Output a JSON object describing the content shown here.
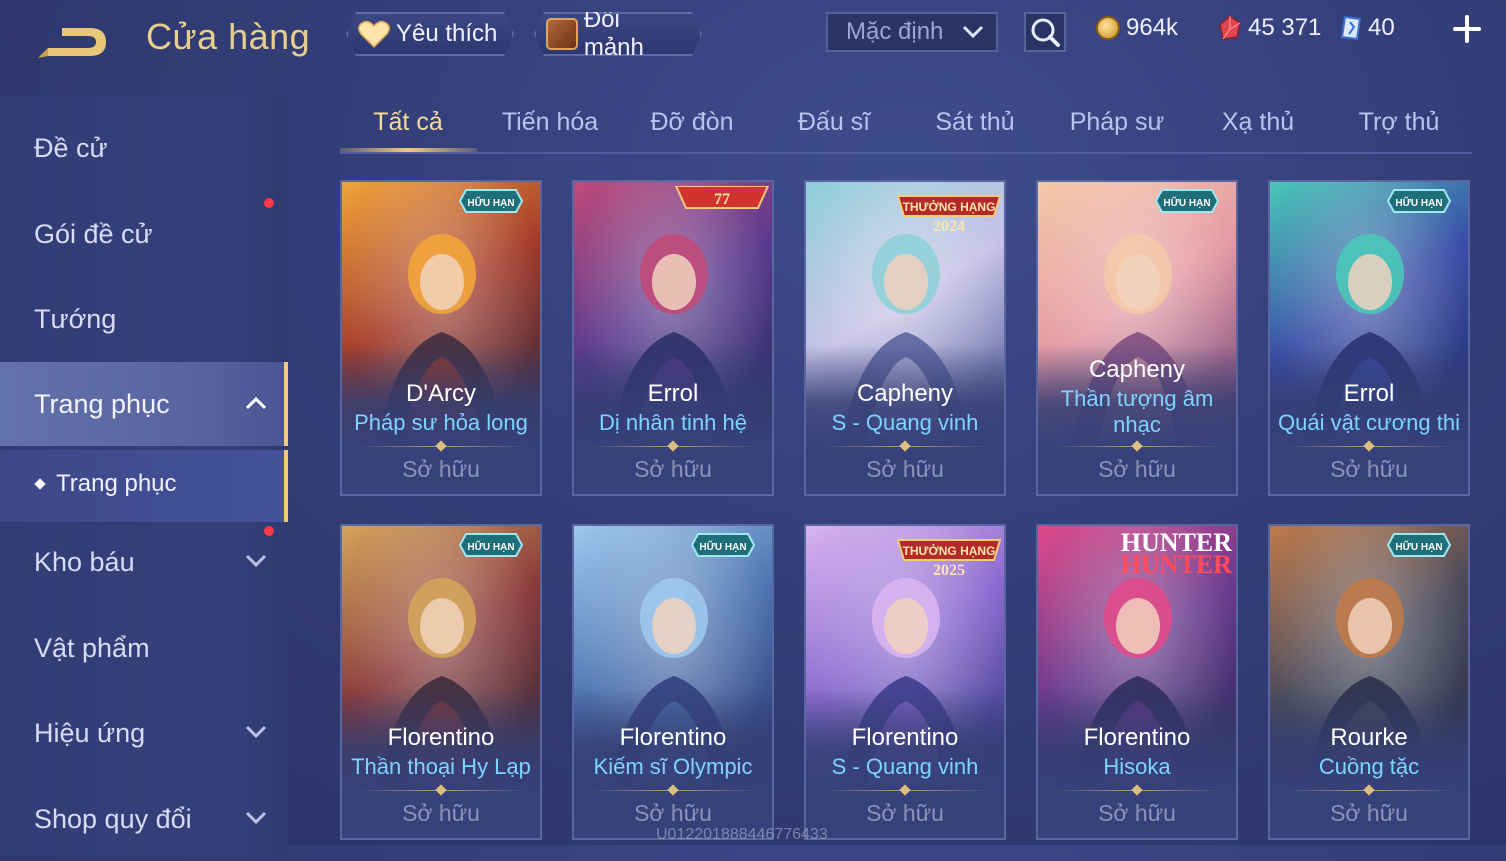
{
  "header": {
    "title": "Cửa hàng",
    "favorite_label": "Yêu thích",
    "fragment_label": "Đổi mảnh",
    "sort_value": "Mặc định",
    "gold": "964k",
    "ruby": "45 371",
    "voucher": "40"
  },
  "sidebar": {
    "items": [
      {
        "label": "Đề cử"
      },
      {
        "label": "Gói đề cử"
      },
      {
        "label": "Tướng"
      },
      {
        "label": "Trang phục"
      },
      {
        "label": "Kho báu"
      },
      {
        "label": "Vật phẩm"
      },
      {
        "label": "Hiệu ứng"
      },
      {
        "label": "Shop quy đổi"
      }
    ],
    "sub_item": "Trang phục"
  },
  "tabs": [
    "Tất cả",
    "Tiến hóa",
    "Đỡ đòn",
    "Đấu sĩ",
    "Sát thủ",
    "Pháp sư",
    "Xạ thủ",
    "Trợ thủ"
  ],
  "cards": [
    {
      "hero": "D'Arcy",
      "skin": "Pháp sư hỏa long",
      "status": "Sở hữu",
      "badge": "HỮU HẠN",
      "colors": [
        "#f2a43a",
        "#a33a2a",
        "#3a2a3e"
      ]
    },
    {
      "hero": "Errol",
      "skin": "Dị nhân tinh hệ",
      "status": "Sở hữu",
      "badge": "77",
      "colors": [
        "#c04a7a",
        "#5a3a8e",
        "#2a2e66"
      ]
    },
    {
      "hero": "Capheny",
      "skin": "S - Quang vinh",
      "status": "Sở hữu",
      "badge": "THƯỞNG HẠNG 2024",
      "colors": [
        "#8fd0d8",
        "#c8c2e8",
        "#55609a"
      ]
    },
    {
      "hero": "Capheny",
      "skin": "Thần tượng âm nhạc",
      "status": "Sở hữu",
      "badge": "HỮU HẠN",
      "colors": [
        "#f4c9a8",
        "#e59aa4",
        "#7a4a7e"
      ]
    },
    {
      "hero": "Errol",
      "skin": "Quái vật cương thi",
      "status": "Sở hữu",
      "badge": "HỮU HẠN",
      "colors": [
        "#49c8b8",
        "#3a4ea8",
        "#263070"
      ]
    },
    {
      "hero": "Florentino",
      "skin": "Thần thoại Hy Lạp",
      "status": "Sở hữu",
      "badge": "A HỮU HẠN",
      "colors": [
        "#d4a45a",
        "#8a3a3a",
        "#3a2a3a"
      ]
    },
    {
      "hero": "Florentino",
      "skin": "Kiếm sĩ Olympic",
      "status": "Sở hữu",
      "badge": "A HỮU HẠN",
      "colors": [
        "#9ec8ee",
        "#4e74b0",
        "#2e3c7a"
      ]
    },
    {
      "hero": "Florentino",
      "skin": "S - Quang vinh",
      "status": "Sở hữu",
      "badge": "S2 THƯỞNG HẠNG 2025",
      "colors": [
        "#d8b4f0",
        "#8a6ad0",
        "#3a3a8a"
      ]
    },
    {
      "hero": "Florentino",
      "skin": "Hisoka",
      "status": "Sở hữu",
      "badge": "HUNTER HUNTER",
      "colors": [
        "#e04a8a",
        "#6a3a8e",
        "#2a2a5a"
      ]
    },
    {
      "hero": "Rourke",
      "skin": "Cuồng tặc",
      "status": "Sở hữu",
      "badge": "A HỮU HẠN",
      "colors": [
        "#c07a4a",
        "#4a4a5a",
        "#2a2e4a"
      ]
    }
  ],
  "watermark": "U012201888446776433"
}
